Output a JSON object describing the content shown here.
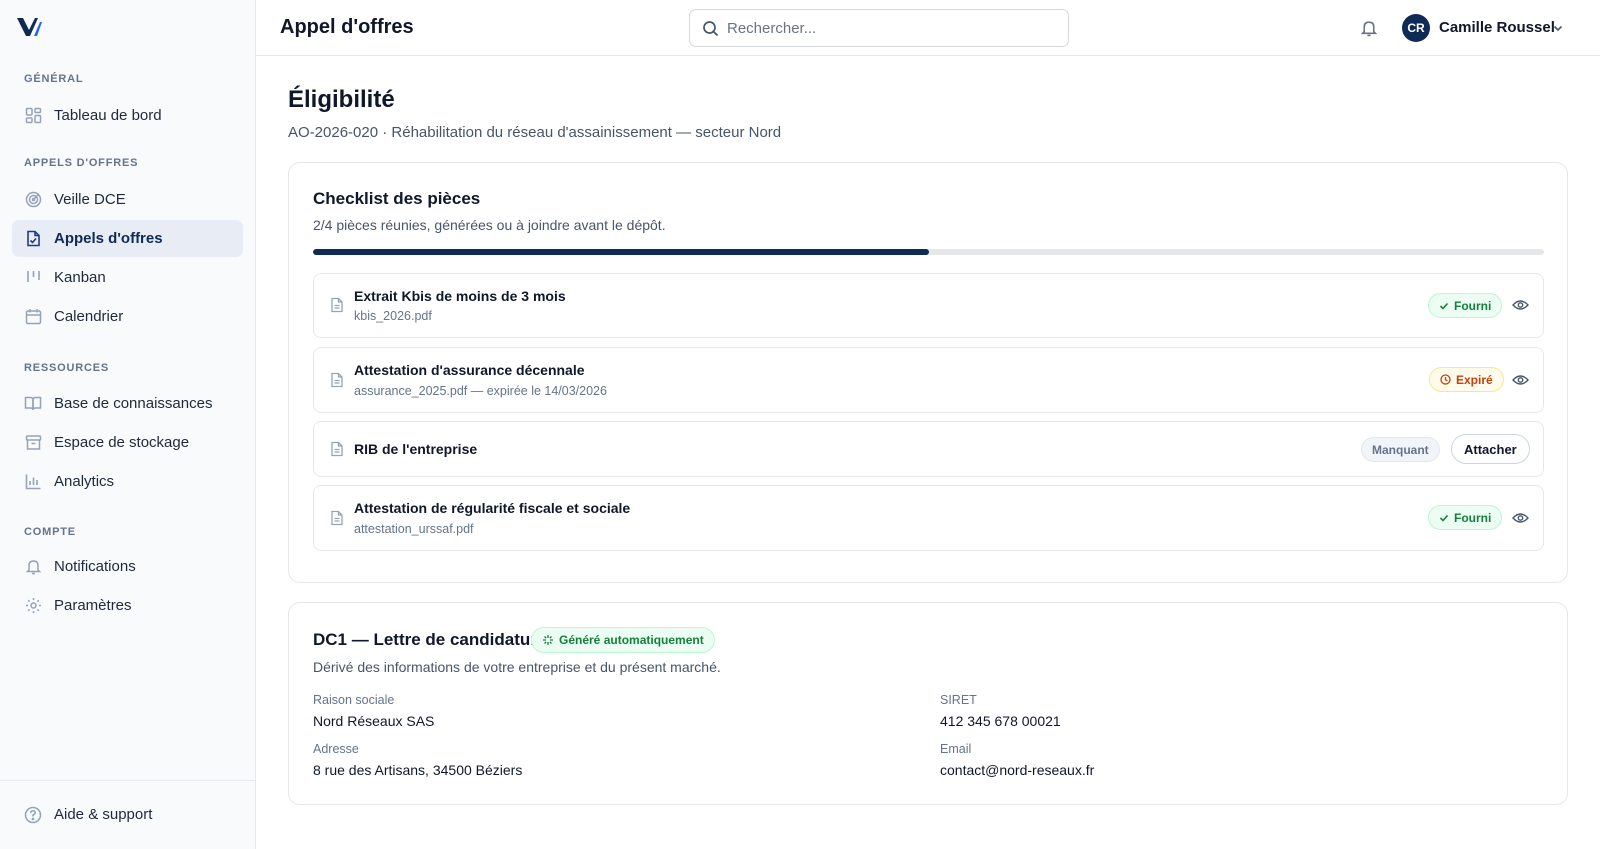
{
  "sidebar": {
    "sections": [
      {
        "label": "Général",
        "items": [
          {
            "label": "Tableau de bord",
            "icon": "dashboard-icon"
          }
        ]
      },
      {
        "label": "Appels d'offres",
        "items": [
          {
            "label": "Veille DCE",
            "icon": "radar-icon"
          },
          {
            "label": "Appels d'offres",
            "icon": "document-icon",
            "active": true
          },
          {
            "label": "Kanban",
            "icon": "kanban-icon"
          },
          {
            "label": "Calendrier",
            "icon": "calendar-icon"
          }
        ]
      },
      {
        "label": "Ressources",
        "items": [
          {
            "label": "Base de connaissances",
            "icon": "book-icon"
          },
          {
            "label": "Espace de stockage",
            "icon": "archive-icon"
          },
          {
            "label": "Analytics",
            "icon": "chart-icon"
          }
        ]
      },
      {
        "label": "Compte",
        "items": [
          {
            "label": "Notifications",
            "icon": "bell-icon"
          },
          {
            "label": "Paramètres",
            "icon": "gear-icon"
          }
        ]
      }
    ],
    "footer": {
      "label": "Aide & support",
      "icon": "help-icon"
    }
  },
  "topbar": {
    "title": "Appel d'offres",
    "search_placeholder": "Rechercher...",
    "user": {
      "initials": "CR",
      "name": "Camille Roussel"
    }
  },
  "page": {
    "title": "Éligibilité",
    "subtitle": "AO-2026-020 · Réhabilitation du réseau d'assainissement — secteur Nord"
  },
  "checklist": {
    "title": "Checklist des pièces",
    "subtitle": "2/4 pièces réunies, générées ou à joindre avant le dépôt.",
    "progress": 0.5,
    "items": [
      {
        "name": "Extrait Kbis de moins de 3 mois",
        "file": "kbis_2026.pdf",
        "status": "Fourni"
      },
      {
        "name": "Attestation d'assurance décennale",
        "file": "assurance_2025.pdf — expirée le 14/03/2026",
        "status": "Expiré"
      },
      {
        "name": "RIB de l'entreprise",
        "file": "",
        "status": "Manquant",
        "action": "Attacher"
      },
      {
        "name": "Attestation de régularité fiscale et sociale",
        "file": "attestation_urssaf.pdf",
        "status": "Fourni"
      }
    ]
  },
  "dc1": {
    "title": "DC1 — Lettre de candidature",
    "badge": "Généré automatiquement",
    "subtitle": "Dérivé des informations de votre entreprise et du présent marché.",
    "fields": {
      "raison_sociale": {
        "label": "Raison sociale",
        "value": "Nord Réseaux SAS"
      },
      "siret": {
        "label": "SIRET",
        "value": "412 345 678 00021"
      },
      "adresse": {
        "label": "Adresse",
        "value": "8 rue des Artisans, 34500 Béziers"
      },
      "email": {
        "label": "Email",
        "value": "contact@nord-reseaux.fr"
      }
    }
  },
  "colors": {
    "primary": "#0f2a55",
    "success": "#15803d",
    "warning": "#c2410c",
    "muted": "#64748b"
  }
}
